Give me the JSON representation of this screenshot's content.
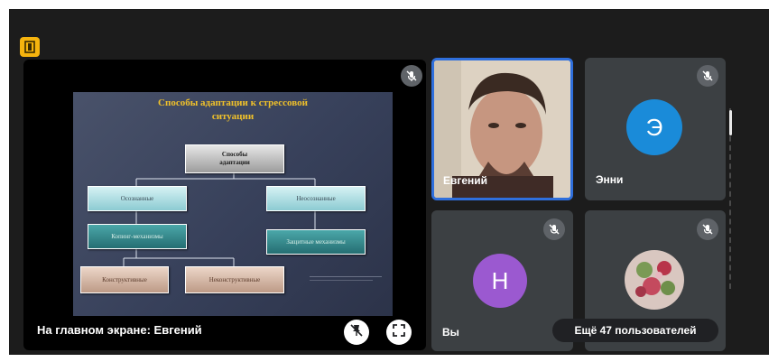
{
  "app": {
    "badge_icon": "door-exit-icon",
    "accent_color": "#f6b40e"
  },
  "main_stage": {
    "caption": "На главном экране: Евгений",
    "mute_icon": "mic-off-icon",
    "controls": [
      {
        "name": "pin-off",
        "icon": "pin-off-icon"
      },
      {
        "name": "fullscreen",
        "icon": "fullscreen-icon"
      }
    ],
    "slide": {
      "title": "Способы адаптации к стрессовой\nситуации",
      "root": "Способы\nадаптации",
      "conscious": "Осознанные",
      "unconscious": "Неосознанные",
      "coping": "Копинг-механизмы",
      "defense": "Защитные механизмы",
      "constructive": "Конструктивные",
      "nonconstructive": "Неконструктивные"
    }
  },
  "participants": [
    {
      "name": "Евгений",
      "type": "video",
      "active_speaker": true
    },
    {
      "name": "Энни",
      "type": "letter",
      "letter": "Э",
      "avatar_color": "#1a8bd9"
    },
    {
      "name": "Вы",
      "type": "letter",
      "letter": "Н",
      "avatar_color": "#9b59d0"
    },
    {
      "name": "",
      "type": "photo"
    }
  ],
  "more_users": "Ещё 47 пользователей"
}
